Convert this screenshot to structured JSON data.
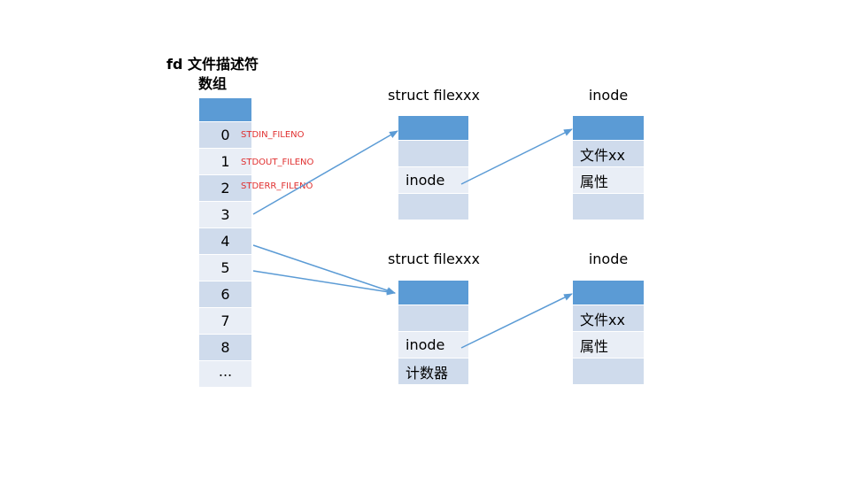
{
  "fd_table": {
    "title_line1": "fd 文件描述符",
    "title_line2": "数组",
    "rows": [
      "0",
      "1",
      "2",
      "3",
      "4",
      "5",
      "6",
      "7",
      "8",
      "..."
    ]
  },
  "fileno_labels": [
    "STDIN_FILENO",
    "STDOUT_FILENO",
    "STDERR_FILENO"
  ],
  "file_struct_1": {
    "title": "struct filexxx",
    "inode_label": "inode"
  },
  "file_struct_2": {
    "title": "struct filexxx",
    "inode_label": "inode",
    "counter_label": "计数器"
  },
  "inode_1": {
    "title": "inode",
    "file_label": "文件xx",
    "attr_label": "属性"
  },
  "inode_2": {
    "title": "inode",
    "file_label": "文件xx",
    "attr_label": "属性"
  },
  "colors": {
    "header": "#5b9bd5",
    "row_dark": "#cfdbec",
    "row_light": "#e9eef6",
    "arrow": "#5b9bd5",
    "fileno_text": "#e03030"
  }
}
